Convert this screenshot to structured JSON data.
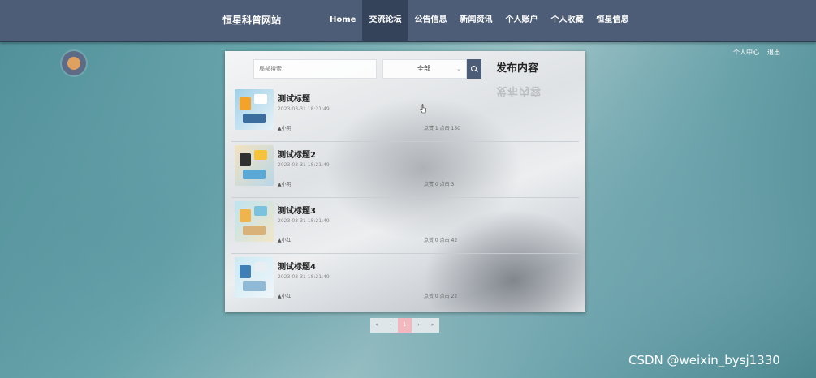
{
  "header": {
    "site_title": "恒星科普网站",
    "nav": [
      {
        "label": "Home",
        "active": false
      },
      {
        "label": "交流论坛",
        "active": true
      },
      {
        "label": "公告信息",
        "active": false
      },
      {
        "label": "新闻资讯",
        "active": false
      },
      {
        "label": "个人账户",
        "active": false
      },
      {
        "label": "个人收藏",
        "active": false
      },
      {
        "label": "恒星信息",
        "active": false
      }
    ]
  },
  "user_links": {
    "profile": "个人中心",
    "logout": "退出"
  },
  "toolbar": {
    "search_placeholder": "局部搜索",
    "category_value": "全部",
    "publish_label": "发布内容"
  },
  "posts": [
    {
      "title": "测试标题",
      "date": "2023-03-31 18:21:49",
      "author": "▲小明",
      "stats": "点赞 1 点击 150"
    },
    {
      "title": "测试标题2",
      "date": "2023-03-31 18:21:49",
      "author": "▲小明",
      "stats": "点赞 0 点击 3"
    },
    {
      "title": "测试标题3",
      "date": "2023-03-31 18:21:49",
      "author": "▲小红",
      "stats": "点赞 0 点击 42"
    },
    {
      "title": "测试标题4",
      "date": "2023-03-31 18:21:49",
      "author": "▲小红",
      "stats": "点赞 0 点击 22"
    }
  ],
  "pagination": {
    "first": "«",
    "prev": "‹",
    "current": "1",
    "next": "›",
    "last": "»"
  },
  "watermark": "CSDN @weixin_bysj1330",
  "colors": {
    "nav_bg": "#4d5d77",
    "nav_active": "#35435a",
    "page_active": "#f3b7bf"
  }
}
